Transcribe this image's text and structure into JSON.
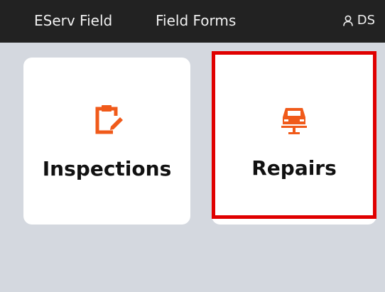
{
  "header": {
    "app_title": "EServ Field",
    "nav_link": "Field Forms",
    "user_initials": "DS",
    "user_icon": "user-icon"
  },
  "cards": [
    {
      "label": "Inspections",
      "icon": "clipboard-edit-icon"
    },
    {
      "label": "Repairs",
      "icon": "car-lift-icon",
      "highlighted": true
    }
  ],
  "colors": {
    "header_bg": "#222222",
    "page_bg": "#d4d8df",
    "card_bg": "#ffffff",
    "icon_accent": "#f05a1a",
    "highlight_border": "#e00000"
  }
}
